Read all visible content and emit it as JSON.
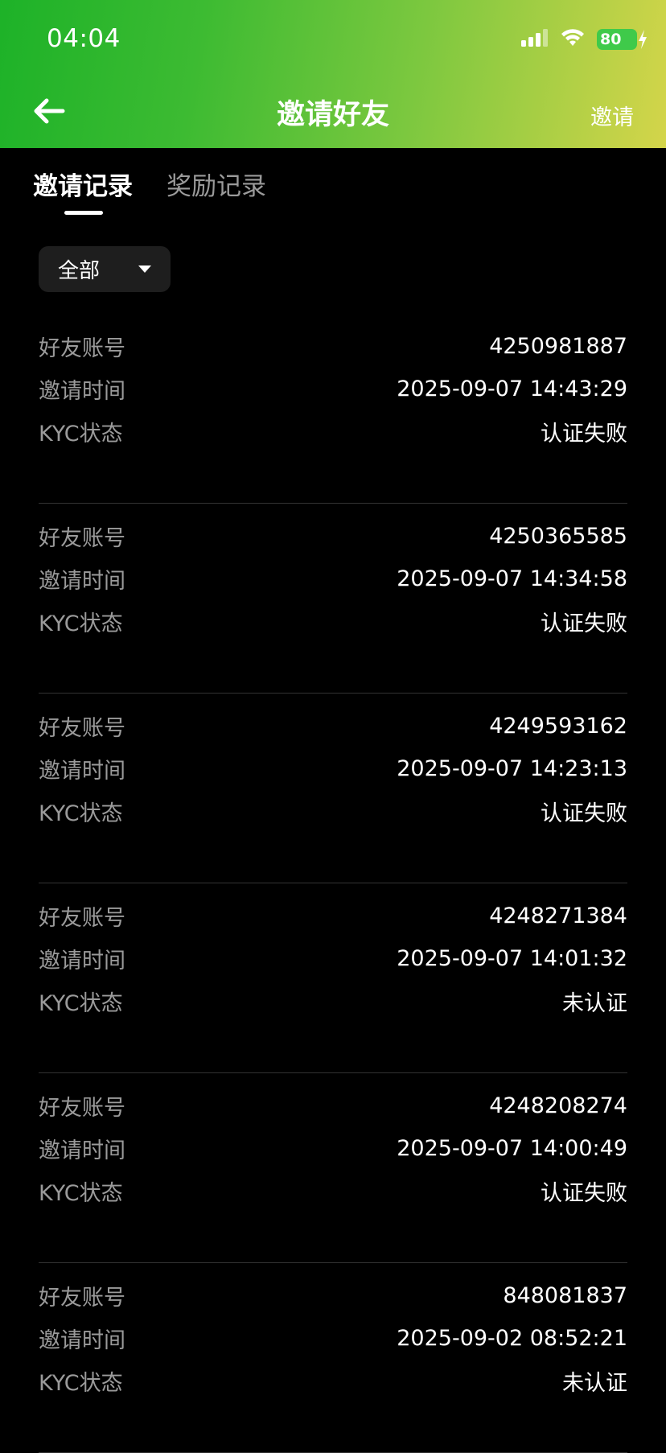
{
  "status_bar": {
    "time": "04:04",
    "battery": "80"
  },
  "nav": {
    "title": "邀请好友",
    "action": "邀请"
  },
  "tabs": [
    {
      "label": "邀请记录",
      "active": true
    },
    {
      "label": "奖励记录",
      "active": false
    }
  ],
  "filter": {
    "selected": "全部"
  },
  "labels": {
    "account": "好友账号",
    "time": "邀请时间",
    "kyc": "KYC状态"
  },
  "records": [
    {
      "account": "4250981887",
      "time": "2025-09-07 14:43:29",
      "kyc": "认证失败"
    },
    {
      "account": "4250365585",
      "time": "2025-09-07 14:34:58",
      "kyc": "认证失败"
    },
    {
      "account": "4249593162",
      "time": "2025-09-07 14:23:13",
      "kyc": "认证失败"
    },
    {
      "account": "4248271384",
      "time": "2025-09-07 14:01:32",
      "kyc": "未认证"
    },
    {
      "account": "4248208274",
      "time": "2025-09-07 14:00:49",
      "kyc": "认证失败"
    },
    {
      "account": "848081837",
      "time": "2025-09-02 08:52:21",
      "kyc": "未认证"
    }
  ],
  "colors": {
    "header_gradient_start": "#1db228",
    "header_gradient_end": "#d4d54a",
    "background": "#000000",
    "label_gray": "#9a9a9a",
    "battery_green": "#3fca4a"
  },
  "icons": {
    "back": "arrow-left-icon",
    "signal": "signal-icon",
    "wifi": "wifi-icon",
    "battery": "battery-icon",
    "filter": "caret-down-icon"
  }
}
